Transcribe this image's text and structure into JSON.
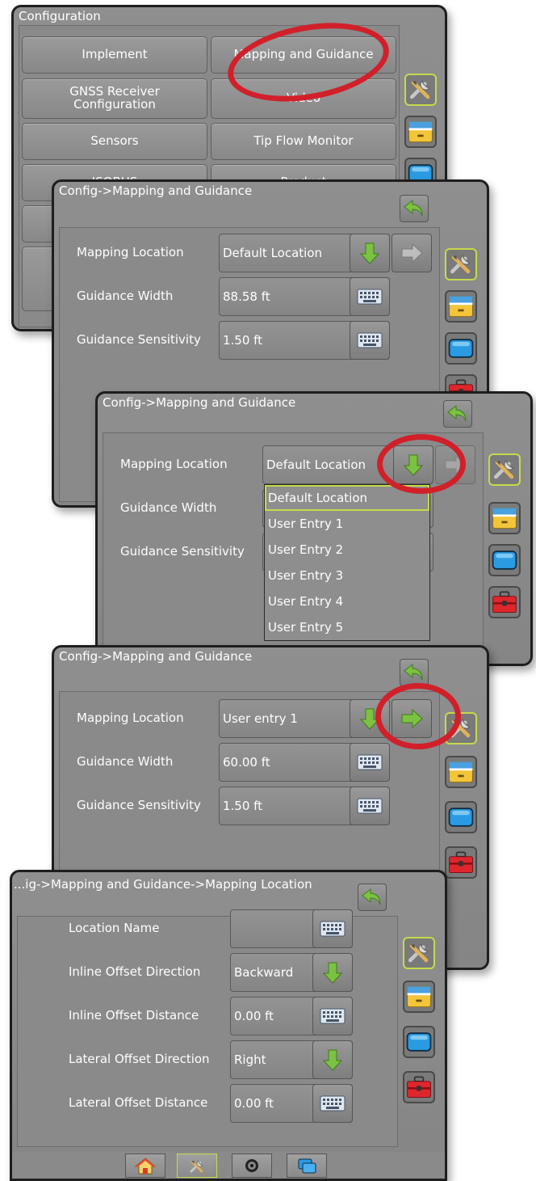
{
  "screen1": {
    "title": "Configuration",
    "buttons": [
      "Implement",
      "Mapping and Guidance",
      "GNSS Receiver Configuration",
      "Video",
      "Sensors",
      "Tip Flow Monitor",
      "ISOBUS",
      "Product"
    ]
  },
  "screen2": {
    "title": "Config->Mapping and Guidance",
    "rows": [
      {
        "label": "Mapping Location",
        "value": "Default Location"
      },
      {
        "label": "Guidance Width",
        "value": "88.58 ft"
      },
      {
        "label": "Guidance Sensitivity",
        "value": "1.50 ft"
      }
    ]
  },
  "screen3": {
    "title": "Config->Mapping and Guidance",
    "rows": [
      {
        "label": "Mapping Location",
        "value": "Default Location"
      },
      {
        "label": "Guidance Width",
        "value": ""
      },
      {
        "label": "Guidance Sensitivity",
        "value": ""
      }
    ],
    "dropdown": [
      "Default Location",
      "User Entry 1",
      "User Entry 2",
      "User Entry 3",
      "User Entry 4",
      "User Entry 5"
    ]
  },
  "screen4": {
    "title": "Config->Mapping and Guidance",
    "rows": [
      {
        "label": "Mapping Location",
        "value": "User entry 1"
      },
      {
        "label": "Guidance Width",
        "value": "60.00 ft"
      },
      {
        "label": "Guidance Sensitivity",
        "value": "1.50 ft"
      }
    ]
  },
  "screen5": {
    "title": "...ig->Mapping and Guidance->Mapping Location",
    "rows": [
      {
        "label": "Location Name",
        "value": ""
      },
      {
        "label": "Inline Offset Direction",
        "value": "Backward"
      },
      {
        "label": "Inline Offset Distance",
        "value": "0.00 ft"
      },
      {
        "label": "Lateral Offset Direction",
        "value": "Right"
      },
      {
        "label": "Lateral Offset Distance",
        "value": "0.00 ft"
      }
    ],
    "bottom_tabs": [
      "home-icon",
      "tools-icon",
      "camera-icon",
      "layers-icon"
    ]
  },
  "colors": {
    "highlight": "#d1202a",
    "selected_border": "#c7d94b",
    "arrow_green": "#7cc242",
    "panel_grey": "#8a8a8a"
  }
}
